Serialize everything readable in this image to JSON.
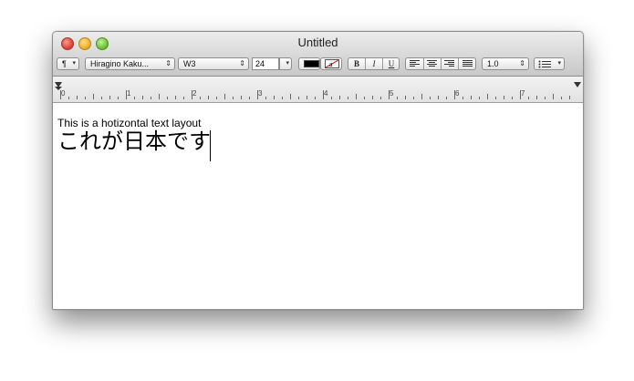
{
  "window": {
    "title": "Untitled"
  },
  "toolbar": {
    "paragraph_label": "¶",
    "font_family": "Hiragino Kaku...",
    "font_weight": "W3",
    "font_size": "24",
    "bold_label": "B",
    "italic_label": "I",
    "underline_label": "U",
    "line_spacing": "1.0",
    "text_color": "#000000"
  },
  "ruler": {
    "labels": [
      "0",
      "1",
      "2",
      "3",
      "4",
      "5",
      "6",
      "7"
    ]
  },
  "document": {
    "line1": "This is a hotizontal text layout",
    "line2": "これが日本です"
  }
}
